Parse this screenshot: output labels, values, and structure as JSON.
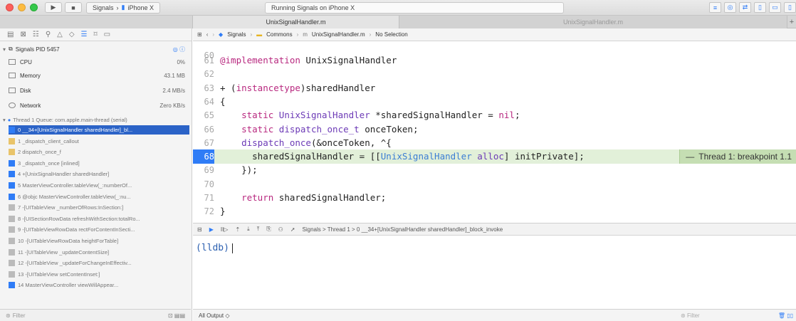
{
  "toolbar": {
    "scheme": "Signals",
    "device": "iPhone X",
    "status": "Running Signals on iPhone X"
  },
  "tabs": [
    "UnixSignalHandler.m",
    "UnixSignalHandler.m"
  ],
  "navigator": {
    "process": "Signals PID 5457",
    "gauges": [
      {
        "label": "CPU",
        "value": "0%"
      },
      {
        "label": "Memory",
        "value": "43.1 MB"
      },
      {
        "label": "Disk",
        "value": "2.4 MB/s"
      },
      {
        "label": "Network",
        "value": "Zero KB/s"
      }
    ],
    "thread": "Thread 1 Queue: com.apple.main-thread (serial)",
    "frames": [
      "0 __34+[UnixSignalHandler sharedHandler]_bl...",
      "1 _dispatch_client_callout",
      "2 dispatch_once_f",
      "3 _dispatch_once [inlined]",
      "4 +[UnixSignalHandler sharedHandler]",
      "5 MasterViewController.tableView(_:numberOf...",
      "6 @objc MasterViewController.tableView(_:nu...",
      "7 -[UITableView _numberOfRows:InSection:]",
      "8 -[UISectionRowData refreshWithSection:totalRo...",
      "9 -[UITableViewRowData rectForContentInSecti...",
      "10 -[UITableViewRowData heightForTable]",
      "11 -[UITableView _updateContentSize]",
      "12 -[UITableView _updateForChangeInEffectiv...",
      "13 -[UITableView setContentInset:]",
      "14 MasterViewController viewWillAppear..."
    ],
    "filter": "Filter"
  },
  "jumpbar": {
    "project": "Signals",
    "group": "Commons",
    "file": "UnixSignalHandler.m",
    "selection": "No Selection"
  },
  "code": {
    "partial_top": "60",
    "lines": [
      {
        "n": "61",
        "parts": [
          [
            "kw",
            "@implementation"
          ],
          [
            "",
            " UnixSignalHandler"
          ]
        ]
      },
      {
        "n": "62",
        "parts": []
      },
      {
        "n": "63",
        "parts": [
          [
            "",
            "+ ("
          ],
          [
            "kw",
            "instancetype"
          ],
          [
            "",
            ")sharedHandler"
          ]
        ]
      },
      {
        "n": "64",
        "parts": [
          [
            "",
            "{"
          ]
        ]
      },
      {
        "n": "65",
        "parts": [
          [
            "",
            "    "
          ],
          [
            "kw",
            "static"
          ],
          [
            "",
            " "
          ],
          [
            "ty",
            "UnixSignalHandler"
          ],
          [
            "",
            " *sharedSignalHandler = "
          ],
          [
            "kw",
            "nil"
          ],
          [
            "",
            ";"
          ]
        ]
      },
      {
        "n": "66",
        "parts": [
          [
            "",
            "    "
          ],
          [
            "kw",
            "static"
          ],
          [
            "",
            " "
          ],
          [
            "ty",
            "dispatch_once_t"
          ],
          [
            "",
            " onceToken;"
          ]
        ]
      },
      {
        "n": "67",
        "parts": [
          [
            "",
            "    "
          ],
          [
            "ty",
            "dispatch_once"
          ],
          [
            "",
            "(&onceToken, ^{"
          ]
        ]
      },
      {
        "n": "68",
        "parts": [
          [
            "",
            "      sharedSignalHandler = [["
          ],
          [
            "cls",
            "UnixSignalHandler"
          ],
          [
            "",
            " "
          ],
          [
            "ty",
            "alloc"
          ],
          [
            "",
            "] initPrivate];"
          ]
        ]
      },
      {
        "n": "69",
        "parts": [
          [
            "",
            "    });"
          ]
        ]
      },
      {
        "n": "70",
        "parts": []
      },
      {
        "n": "71",
        "parts": [
          [
            "",
            "    "
          ],
          [
            "kw",
            "return"
          ],
          [
            "",
            " sharedSignalHandler;"
          ]
        ]
      },
      {
        "n": "72",
        "parts": [
          [
            "",
            "}"
          ]
        ]
      }
    ],
    "highlight_line": "68",
    "breakpoint_label": "Thread 1: breakpoint 1.1"
  },
  "debugbar": {
    "path": "Signals > Thread 1 > 0 __34+[UnixSignalHandler sharedHandler]_block_invoke"
  },
  "console": {
    "prompt": "(lldb)",
    "output_selector": "All Output",
    "filter": "Filter"
  },
  "colors": {
    "highlight": "#e2f0d9",
    "breakpoint_badge": "#c5deb3",
    "line_marker": "#2f7cf6",
    "selection": "#2b63c7"
  }
}
